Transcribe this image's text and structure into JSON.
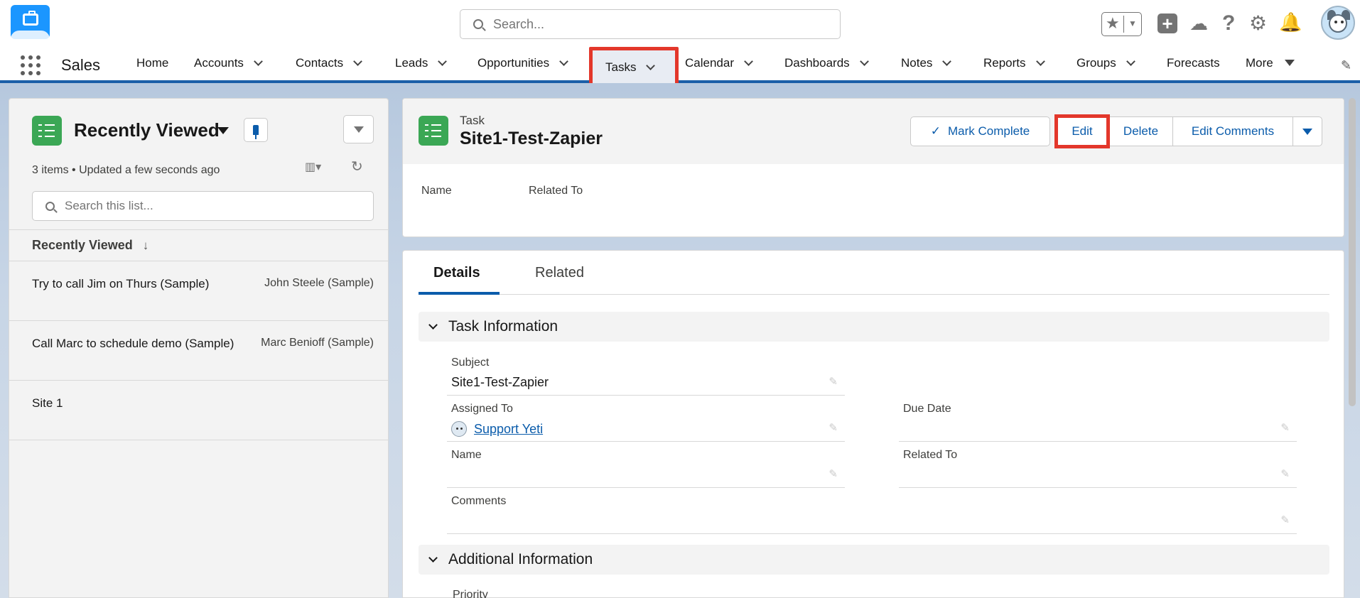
{
  "header": {
    "search_placeholder": "Search...",
    "icons": [
      "favorites-star-icon",
      "add-plus-icon",
      "trailhead-icon",
      "help-icon",
      "setup-gear-icon",
      "notifications-bell-icon",
      "user-avatar"
    ]
  },
  "nav": {
    "app_name": "Sales",
    "items": [
      {
        "label": "Home",
        "has_menu": false
      },
      {
        "label": "Accounts",
        "has_menu": true
      },
      {
        "label": "Contacts",
        "has_menu": true
      },
      {
        "label": "Leads",
        "has_menu": true
      },
      {
        "label": "Opportunities",
        "has_menu": true
      },
      {
        "label": "Tasks",
        "has_menu": true,
        "active": true
      },
      {
        "label": "Calendar",
        "has_menu": true
      },
      {
        "label": "Dashboards",
        "has_menu": true
      },
      {
        "label": "Notes",
        "has_menu": true
      },
      {
        "label": "Reports",
        "has_menu": true
      },
      {
        "label": "Groups",
        "has_menu": true
      },
      {
        "label": "Forecasts",
        "has_menu": false
      },
      {
        "label": "More",
        "has_menu": true
      }
    ]
  },
  "list_panel": {
    "title": "Recently Viewed",
    "meta": "3 items • Updated a few seconds ago",
    "search_placeholder": "Search this list...",
    "column_header": "Recently Viewed",
    "rows": [
      {
        "primary": "Try to call Jim on Thurs (Sample)",
        "secondary": "John Steele (Sample)"
      },
      {
        "primary": "Call Marc to schedule demo (Sample)",
        "secondary": "Marc Benioff (Sample)"
      },
      {
        "primary": "Site 1",
        "secondary": ""
      }
    ]
  },
  "record": {
    "type_label": "Task",
    "title": "Site1-Test-Zapier",
    "buttons": {
      "mark_complete": "Mark Complete",
      "edit": "Edit",
      "delete": "Delete",
      "edit_comments": "Edit Comments"
    },
    "highlights": {
      "name_label": "Name",
      "related_label": "Related To"
    }
  },
  "details": {
    "tabs": [
      "Details",
      "Related"
    ],
    "section_task": "Task Information",
    "section_additional": "Additional Information",
    "fields": {
      "subject": {
        "label": "Subject",
        "value": "Site1-Test-Zapier"
      },
      "assigned_to": {
        "label": "Assigned To",
        "value": "Support Yeti"
      },
      "due_date": {
        "label": "Due Date",
        "value": ""
      },
      "name": {
        "label": "Name",
        "value": ""
      },
      "related_to": {
        "label": "Related To",
        "value": ""
      },
      "comments": {
        "label": "Comments",
        "value": ""
      }
    },
    "next_field_label": "Priority"
  },
  "colors": {
    "brand_blue": "#0b5cab",
    "task_green": "#3ba755",
    "highlight_red": "#e3372b"
  }
}
